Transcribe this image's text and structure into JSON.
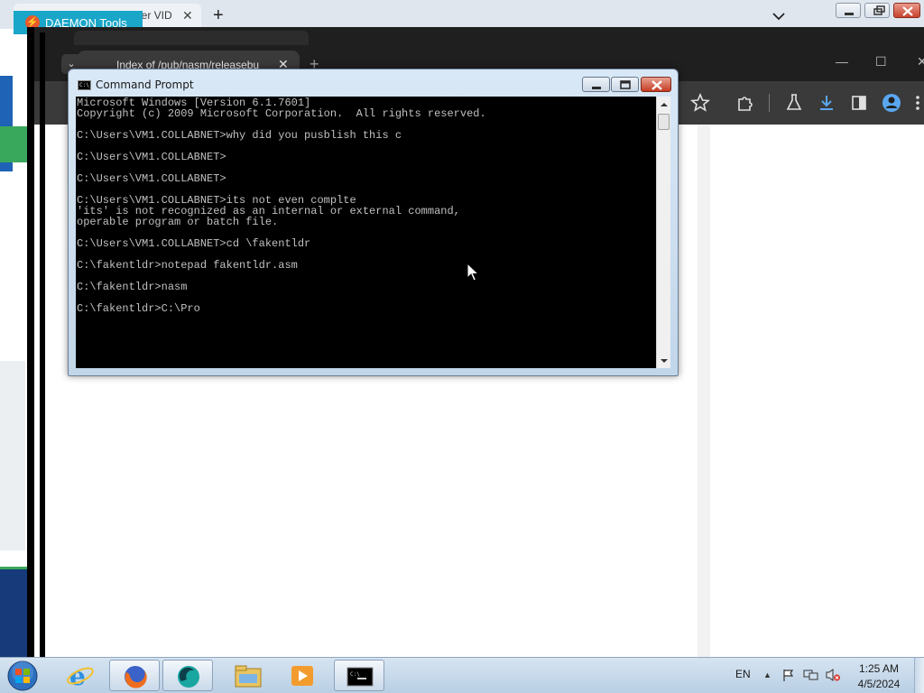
{
  "background_browser": {
    "daemon_badge": "DAEMON Tools",
    "tab_title_partial": "her VID"
  },
  "chrome": {
    "tab_title": "Index of /pub/nasm/releasebu"
  },
  "cmd": {
    "title": "Command Prompt",
    "lines": [
      "Microsoft Windows [Version 6.1.7601]",
      "Copyright (c) 2009 Microsoft Corporation.  All rights reserved.",
      "",
      "C:\\Users\\VM1.COLLABNET>why did you pusblish this c",
      "",
      "C:\\Users\\VM1.COLLABNET>",
      "",
      "C:\\Users\\VM1.COLLABNET>",
      "",
      "C:\\Users\\VM1.COLLABNET>its not even complte",
      "'its' is not recognized as an internal or external command,",
      "operable program or batch file.",
      "",
      "C:\\Users\\VM1.COLLABNET>cd \\fakentldr",
      "",
      "C:\\fakentldr>notepad fakentldr.asm",
      "",
      "C:\\fakentldr>nasm",
      "",
      "C:\\fakentldr>C:\\Pro"
    ]
  },
  "taskbar": {
    "apps": [
      "internet-explorer",
      "firefox",
      "daemon-tools",
      "file-explorer",
      "media-player",
      "command-prompt"
    ],
    "language": "EN",
    "time": "1:25 AM",
    "date": "4/5/2024"
  },
  "colors": {
    "console_bg": "#000000",
    "console_fg": "#c0c0c0",
    "chrome_dark": "#3a3a3a",
    "daemon_accent": "#1aa6c8"
  }
}
